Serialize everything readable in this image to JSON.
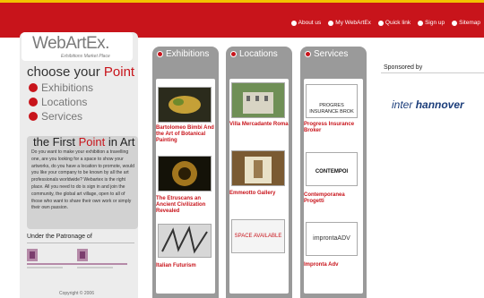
{
  "topnav": [
    "About us",
    "My WebArtEx",
    "Quick link",
    "Sign up",
    "Sitemap"
  ],
  "logo": {
    "text": "WebArtEx.",
    "sub": "Exhibitions Market Place"
  },
  "choose": {
    "before": "choose your ",
    "accent": "Point"
  },
  "menu": [
    "Exhibitions",
    "Locations",
    "Services"
  ],
  "first": {
    "title_before": "the First ",
    "title_accent": "Point",
    "title_after": " in Art",
    "text": "Do you want to make your exhibition a travelling one, are you looking for a space to show your artworks, do you have a location to promote, would you like your company to be known by all the art professionals worldwide? Webartex is the right place. All you need to do is sign in and join the community, the global art village, open to all of those who want to share their own work or simply their own passion."
  },
  "patronage": "Under the Patronage of",
  "copyright": "Copyright © 2006",
  "columns": {
    "exhibitions": {
      "title": "Exhibitions",
      "items": [
        "Bartolomeo Bimbi And the Art of Botanical Painting",
        "The Etruscans an Ancient Civilization Revealed",
        "Italian Futurism"
      ]
    },
    "locations": {
      "title": "Locations",
      "items": [
        "Villa Mercadante Roma",
        "Emmeotto Gallery",
        "SPACE AVAILABLE"
      ]
    },
    "services": {
      "title": "Services",
      "items": [
        "Progress Insurance Broker",
        "Contemporanea Progetti",
        "Impronta Adv"
      ]
    }
  },
  "sponsored": "Sponsored by",
  "sponsor_logo": {
    "part1": "inter ",
    "part2": "hannover"
  },
  "service_logos": {
    "progress": "PROGRES INSURANCE BROK",
    "contempo": "CONTEMPOI",
    "impronta": "improntaADV"
  }
}
